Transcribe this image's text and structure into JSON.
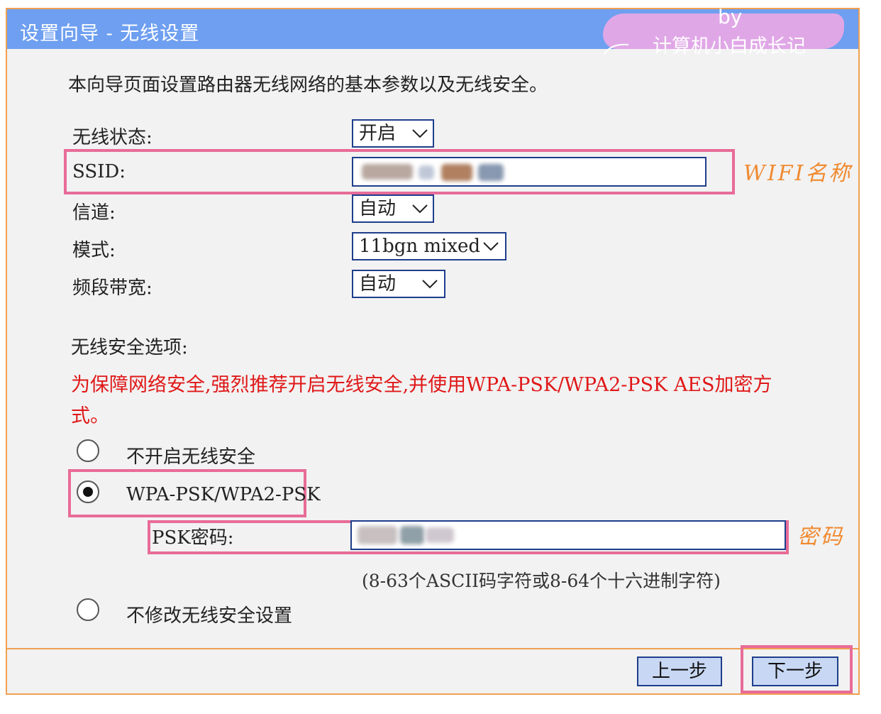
{
  "window": {
    "title": "设置向导 - 无线设置"
  },
  "watermark": {
    "line1": "by",
    "line2": "计算机小白成长记"
  },
  "intro": "本向导页面设置路由器无线网络的基本参数以及无线安全。",
  "form": {
    "wireless_status": {
      "label": "无线状态:",
      "value": "开启"
    },
    "ssid": {
      "label": "SSID:",
      "value": ""
    },
    "channel": {
      "label": "信道:",
      "value": "自动"
    },
    "mode": {
      "label": "模式:",
      "value": "11bgn mixed"
    },
    "bandwidth": {
      "label": "频段带宽:",
      "value": "自动"
    }
  },
  "security": {
    "heading": "无线安全选项:",
    "warning": "为保障网络安全,强烈推荐开启无线安全,并使用WPA-PSK/WPA2-PSK AES加密方式。",
    "options": [
      {
        "label": "不开启无线安全",
        "selected": false
      },
      {
        "label": "WPA-PSK/WPA2-PSK",
        "selected": true
      },
      {
        "label": "不修改无线安全设置",
        "selected": false
      }
    ],
    "psk": {
      "label": "PSK密码:",
      "value": "",
      "hint": "(8-63个ASCII码字符或8-64个十六进制字符)"
    }
  },
  "annotations": {
    "ssid": "WIFI名称",
    "psk": "密码"
  },
  "buttons": {
    "prev": "上一步",
    "next": "下一步"
  },
  "colors": {
    "titlebar": "#6e9ff0",
    "frame": "#f0a050",
    "highlight": "#e86c98",
    "annotation": "#f08a30",
    "warning": "#e01818",
    "input_border": "#1e3e8c",
    "button_bg": "#c8d8f4"
  }
}
